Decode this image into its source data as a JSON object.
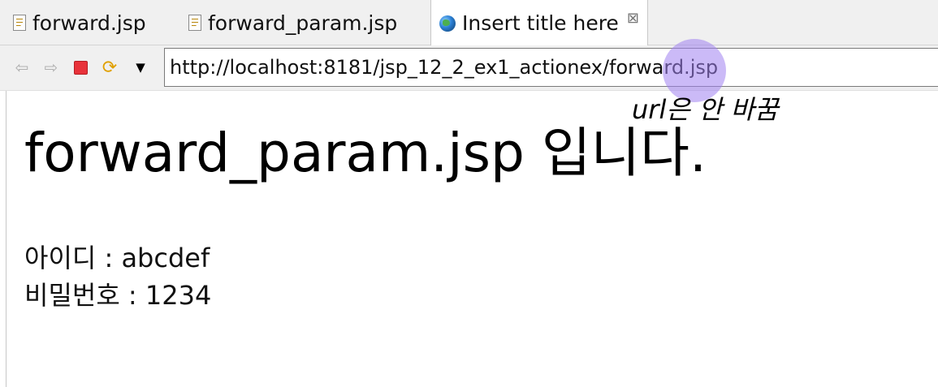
{
  "tabs": [
    {
      "label": "forward.jsp",
      "icon": "jsp-file-icon"
    },
    {
      "label": "forward_param.jsp",
      "icon": "jsp-file-icon"
    },
    {
      "label": "Insert title here",
      "icon": "globe-icon",
      "close_glyph": "⊠",
      "active": true
    }
  ],
  "toolbar": {
    "back_icon": "back-arrow-icon",
    "forward_icon": "forward-arrow-icon",
    "stop_icon": "stop-icon",
    "refresh_icon": "refresh-icon",
    "menu_icon": "dropdown-icon",
    "url": "http://localhost:8181/jsp_12_2_ex1_actionex/forward.jsp"
  },
  "annotation": {
    "text": "url은 안 바꿈",
    "highlight_color": "#a082f0"
  },
  "page": {
    "heading": "forward_param.jsp 입니다.",
    "id_line": "아이디 : abcdef",
    "password_line": "비밀번호 : 1234"
  }
}
